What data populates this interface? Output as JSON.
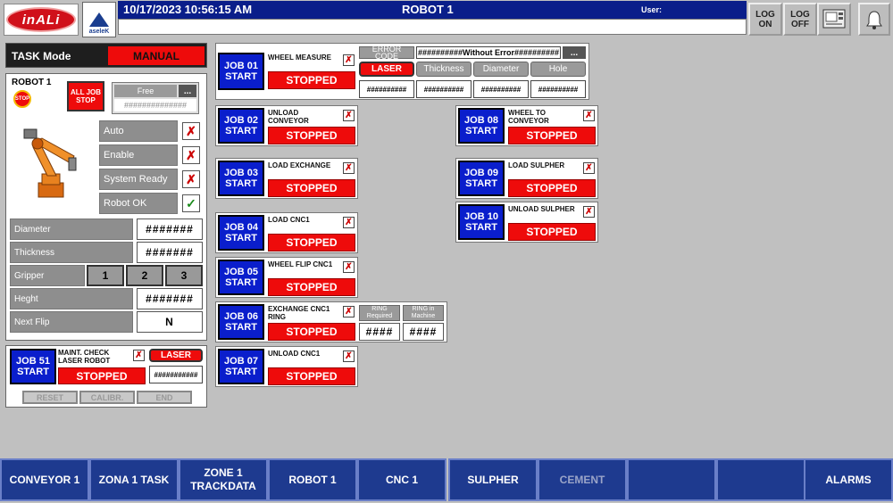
{
  "header": {
    "logo_text": "inALi",
    "brand2_text": "aseleK",
    "datetime": "10/17/2023 10:56:15 AM",
    "title": "ROBOT 1",
    "user_label": "User:",
    "log_on": "LOG ON",
    "log_off": "LOG OFF",
    "colors": {
      "topbar": "#0a1e8a",
      "stopped": "#ee0b0b",
      "job_button": "#0a1ecc"
    }
  },
  "task_mode": {
    "label": "TASK Mode",
    "value": "MANUAL"
  },
  "robot": {
    "name": "ROBOT 1",
    "stop_badge": "STOP",
    "all_job_stop": "ALL JOB STOP",
    "free_label": "Free",
    "dots": "...",
    "hash": "##############",
    "status": [
      {
        "label": "Auto",
        "check": "✗"
      },
      {
        "label": "Enable",
        "check": "✗"
      },
      {
        "label": "System Ready",
        "check": "✗"
      },
      {
        "label": "Robot OK",
        "check": "✓"
      }
    ],
    "params": [
      {
        "label": "Diameter",
        "value": "#######"
      },
      {
        "label": "Thickness",
        "value": "#######"
      }
    ],
    "gripper": {
      "label": "Gripper",
      "options": [
        "1",
        "2",
        "3"
      ]
    },
    "height": {
      "label": "Heght",
      "value": "#######"
    },
    "next_flip": {
      "label": "Next Flip",
      "value": "N"
    }
  },
  "maint": {
    "job": "JOB 51",
    "start": "START",
    "title": "MAINT. CHECK LASER ROBOT",
    "status": "STOPPED",
    "laser": "LASER",
    "hash": "###########",
    "buttons": [
      "RESET",
      "CALIBR.",
      "END"
    ]
  },
  "wheel_measure": {
    "error_code_label": "ERROR CODE",
    "error_code_value": "##########Without Error##########",
    "dots": "...",
    "laser": "LASER",
    "tabs": [
      "Thickness",
      "Diameter",
      "Hole"
    ],
    "values": [
      "##########",
      "##########",
      "##########",
      "##########"
    ]
  },
  "exchange": {
    "ring_required": "RING Required",
    "ring_machine": "RING in Machine",
    "val1": "####",
    "val2": "####"
  },
  "jobs": [
    {
      "job": "JOB 01",
      "start": "START",
      "title": "WHEEL MEASURE",
      "status": "STOPPED"
    },
    {
      "job": "JOB 02",
      "start": "START",
      "title": "UNLOAD CONVEYOR",
      "status": "STOPPED"
    },
    {
      "job": "JOB 03",
      "start": "START",
      "title": "LOAD EXCHANGE",
      "status": "STOPPED"
    },
    {
      "job": "JOB 04",
      "start": "START",
      "title": "LOAD CNC1",
      "status": "STOPPED"
    },
    {
      "job": "JOB 05",
      "start": "START",
      "title": "WHEEL FLIP CNC1",
      "status": "STOPPED"
    },
    {
      "job": "JOB 06",
      "start": "START",
      "title": "EXCHANGE CNC1 RING",
      "status": "STOPPED"
    },
    {
      "job": "JOB 07",
      "start": "START",
      "title": "UNLOAD CNC1",
      "status": "STOPPED"
    },
    {
      "job": "JOB 08",
      "start": "START",
      "title": "WHEEL TO CONVEYOR",
      "status": "STOPPED"
    },
    {
      "job": "JOB 09",
      "start": "START",
      "title": "LOAD SULPHER",
      "status": "STOPPED"
    },
    {
      "job": "JOB 10",
      "start": "START",
      "title": "UNLOAD SULPHER",
      "status": "STOPPED"
    }
  ],
  "nav": [
    "CONVEYOR 1",
    "ZONA 1 TASK",
    "ZONE 1 TRACKDATA",
    "ROBOT 1",
    "CNC 1",
    "SULPHER",
    "CEMENT",
    "",
    "",
    "ALARMS"
  ]
}
